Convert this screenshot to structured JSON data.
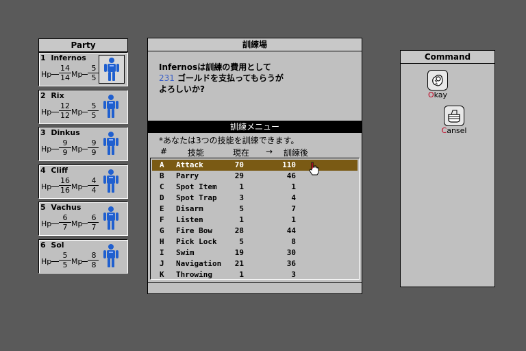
{
  "party": {
    "title": "Party",
    "members": [
      {
        "num": "1",
        "name": "Infernos",
        "hp_cur": "14",
        "hp_max": "14",
        "mp_cur": "5",
        "mp_max": "5",
        "selected": true
      },
      {
        "num": "2",
        "name": "Rix",
        "hp_cur": "12",
        "hp_max": "12",
        "mp_cur": "5",
        "mp_max": "5",
        "selected": false
      },
      {
        "num": "3",
        "name": "Dinkus",
        "hp_cur": "9",
        "hp_max": "9",
        "mp_cur": "9",
        "mp_max": "9",
        "selected": false
      },
      {
        "num": "4",
        "name": "Cliff",
        "hp_cur": "16",
        "hp_max": "16",
        "mp_cur": "4",
        "mp_max": "4",
        "selected": false
      },
      {
        "num": "5",
        "name": "Vachus",
        "hp_cur": "6",
        "hp_max": "7",
        "mp_cur": "6",
        "mp_max": "7",
        "selected": false
      },
      {
        "num": "6",
        "name": "Sol",
        "hp_cur": "5",
        "hp_max": "5",
        "mp_cur": "8",
        "mp_max": "8",
        "selected": false
      }
    ],
    "hp_label": "Hp",
    "mp_label": "Mp"
  },
  "hall": {
    "title": "訓練場",
    "msg_line1": "Infernosは訓練の費用として",
    "gold_amount": "231",
    "msg_line2_rest": " ゴールドを支払ってもらうが",
    "msg_line3": "よろしいか?",
    "menu_title": "訓練メニュー",
    "note": "*あなたは3つの技能を訓練できます。",
    "headers": {
      "key": "#",
      "skill": "技能",
      "current": "現在",
      "arrow": "→",
      "after": "訓練後"
    },
    "skills": [
      {
        "key": "A",
        "name": "Attack",
        "current": "70",
        "after": "110",
        "selected": true
      },
      {
        "key": "B",
        "name": "Parry",
        "current": "29",
        "after": "46",
        "selected": false
      },
      {
        "key": "C",
        "name": "Spot Item",
        "current": "1",
        "after": "1",
        "selected": false
      },
      {
        "key": "D",
        "name": "Spot Trap",
        "current": "3",
        "after": "4",
        "selected": false
      },
      {
        "key": "E",
        "name": "Disarm",
        "current": "5",
        "after": "7",
        "selected": false
      },
      {
        "key": "F",
        "name": "Listen",
        "current": "1",
        "after": "1",
        "selected": false
      },
      {
        "key": "G",
        "name": "Fire Bow",
        "current": "28",
        "after": "44",
        "selected": false
      },
      {
        "key": "H",
        "name": "Pick Lock",
        "current": "5",
        "after": "8",
        "selected": false
      },
      {
        "key": "I",
        "name": "Swim",
        "current": "19",
        "after": "30",
        "selected": false
      },
      {
        "key": "J",
        "name": "Navigation",
        "current": "21",
        "after": "36",
        "selected": false
      },
      {
        "key": "K",
        "name": "Throwing",
        "current": "1",
        "after": "3",
        "selected": false
      }
    ]
  },
  "command": {
    "title": "Command",
    "okay_hot": "O",
    "okay_rest": "kay",
    "cancel_hot": "C",
    "cancel_rest": "ansel"
  },
  "colors": {
    "background": "#5a5a5a",
    "panel": "#c0c0c0",
    "selected_row": "#7a5a14",
    "gold_text": "#3a5fc8",
    "hotkey": "#c00020",
    "portrait": "#1f5fcf"
  }
}
